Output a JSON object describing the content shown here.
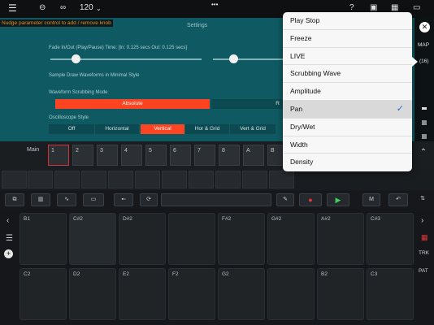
{
  "topbar": {
    "menu_icon": "hamburger-icon",
    "tempo": "120",
    "help": "?",
    "dots": "•••"
  },
  "settings": {
    "title": "Settings",
    "hint": "Nudge parameter control to add / remove knob",
    "fade_label": "Fade In/Out (Play/Pause) Time: [In: 0.125 secs  Out: 0.125 secs]",
    "sample_draw_label": "Sample Draw Waveforms in Minimal Style",
    "scrub_label": "Waveform Scrubbing Mode",
    "scrub_selected": "Absolute",
    "scrub_other": "R",
    "osc_label": "Oscilloscope Style",
    "osc_options": [
      "Off",
      "Horizontal",
      "Vertical",
      "Hor & Grid",
      "Vert & Grid"
    ],
    "osc_selected_index": 2
  },
  "right_strip": {
    "map": "MAP",
    "count": "(16)"
  },
  "keys": {
    "main": "Main",
    "numbers": [
      "1",
      "2",
      "3",
      "4",
      "5",
      "6",
      "7",
      "8",
      "A",
      "B"
    ]
  },
  "pads": {
    "row1": [
      "B1",
      "C#2",
      "D#2",
      "",
      "F#2",
      "G#2",
      "A#2",
      "C#3"
    ],
    "row2": [
      "C2",
      "D2",
      "E2",
      "F2",
      "G2",
      "",
      "B2",
      "C3"
    ]
  },
  "sidebar": {
    "trk": "TRK",
    "pat": "PAT"
  },
  "popup": {
    "items": [
      "Play Stop",
      "Freeze",
      "LIVE",
      "Scrubbing Wave",
      "Amplitude",
      "Pan",
      "Dry/Wet",
      "Width",
      "Density"
    ],
    "selected": "Pan"
  }
}
